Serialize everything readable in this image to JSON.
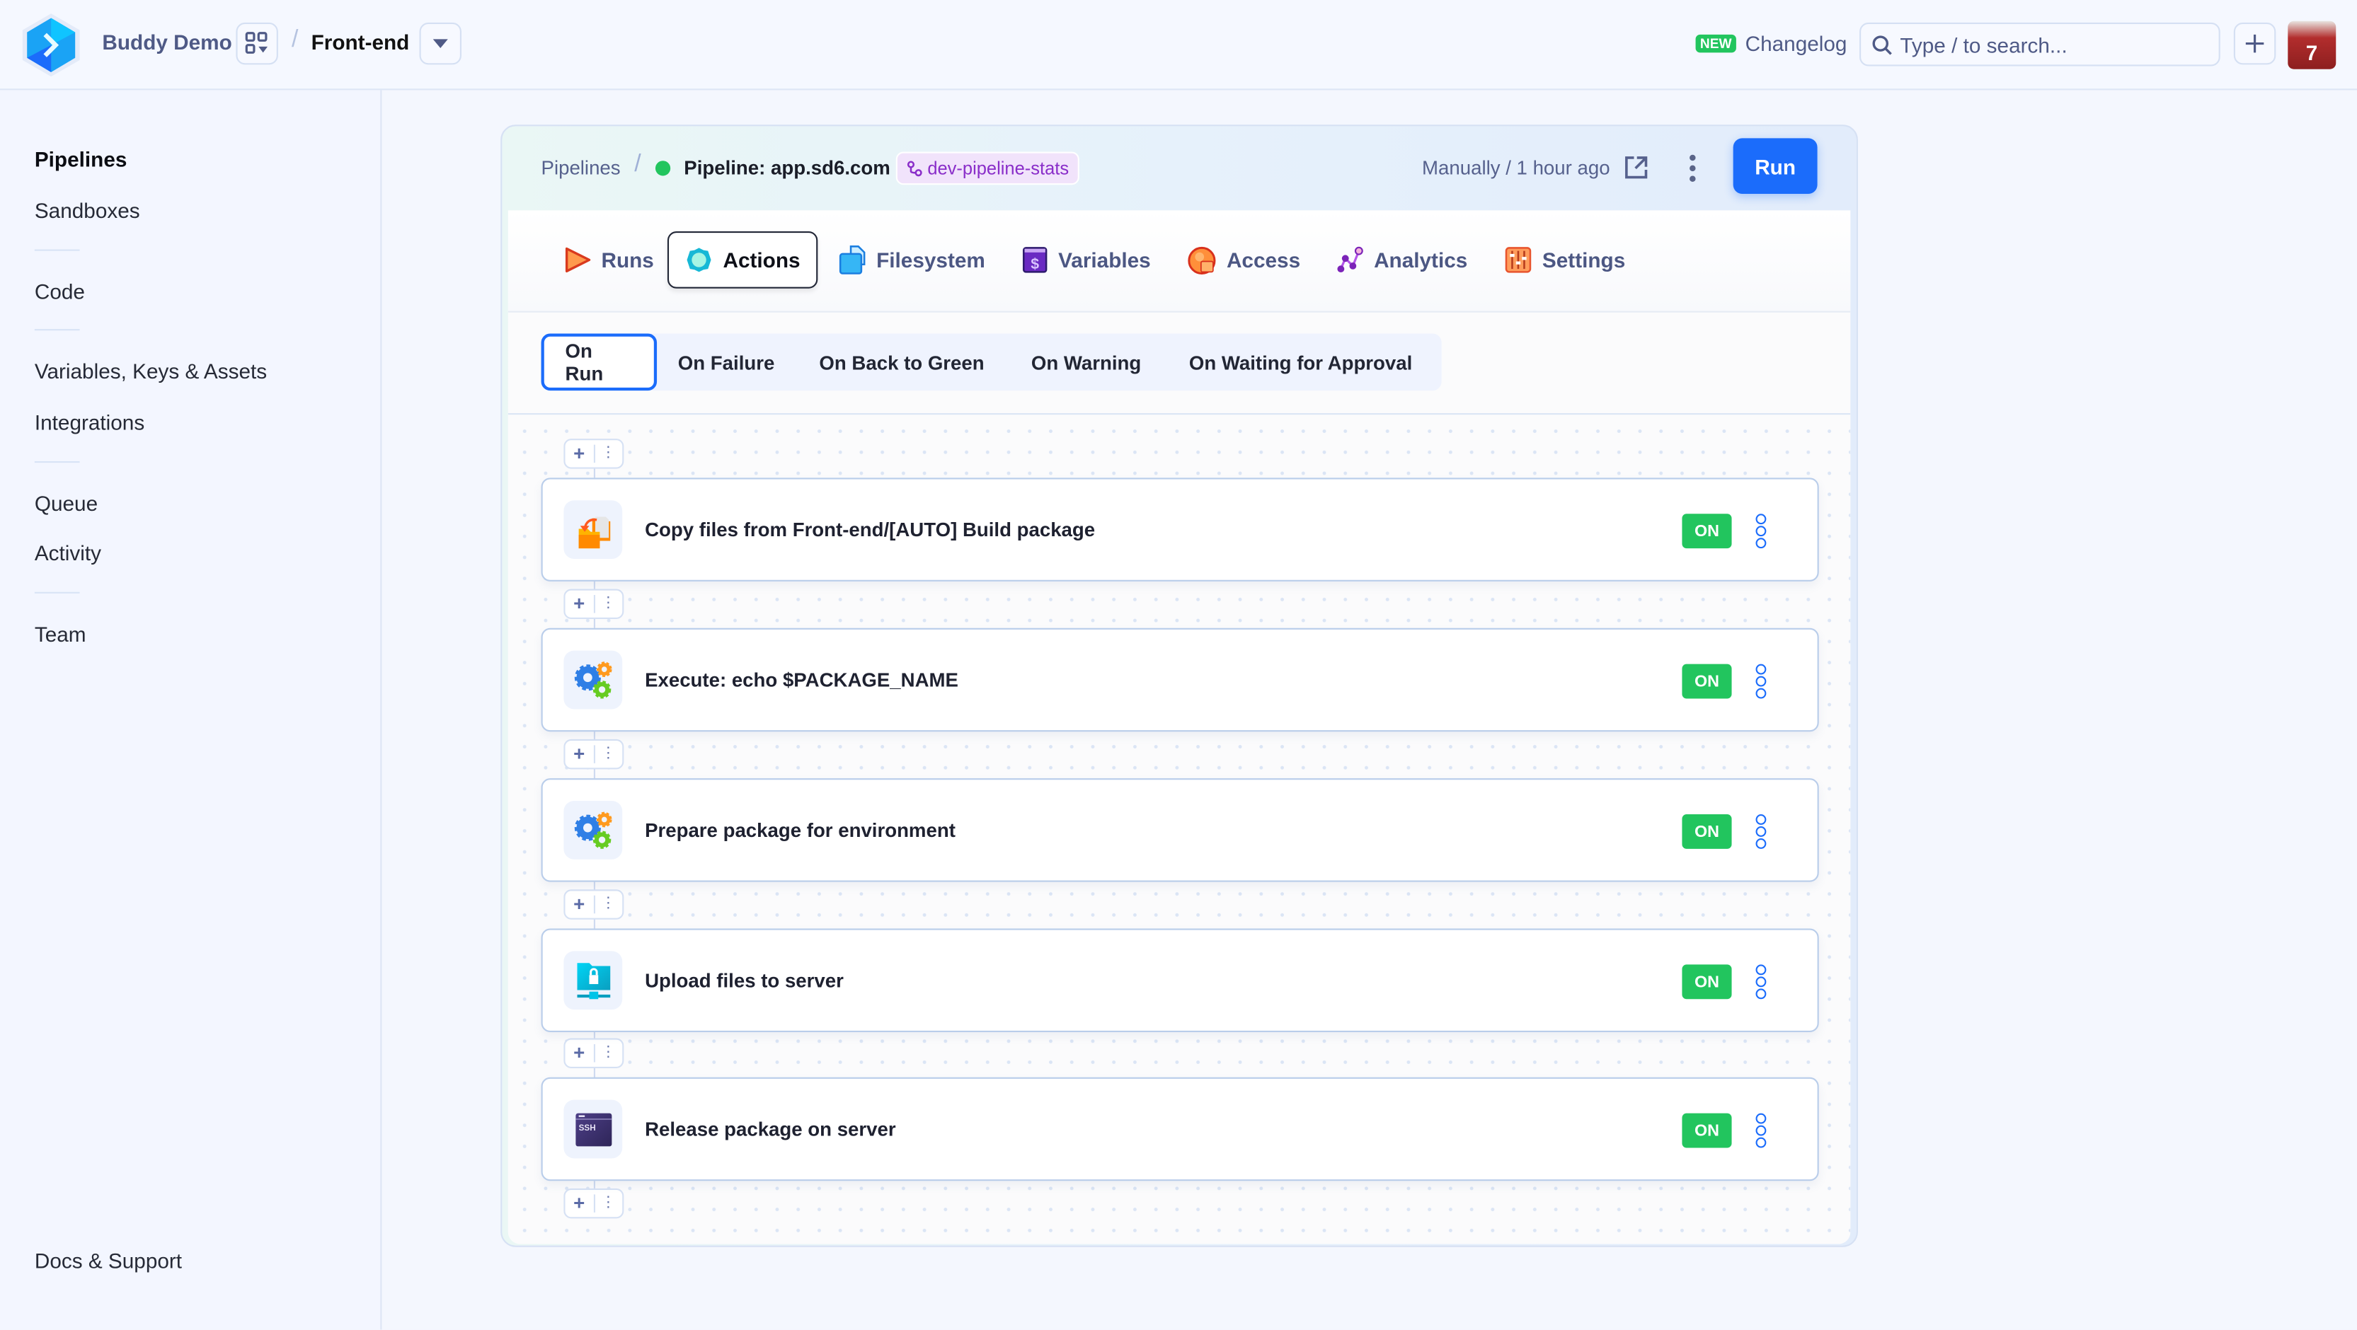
{
  "topbar": {
    "org_name": "Buddy Demo",
    "project_name": "Front-end",
    "new_badge": "NEW",
    "changelog": "Changelog",
    "search_placeholder": "Type / to search...",
    "avatar_number": "7"
  },
  "sidebar": {
    "items": [
      {
        "label": "Pipelines",
        "active": true
      },
      {
        "label": "Sandboxes"
      },
      {
        "label": "Code"
      },
      {
        "label": "Variables, Keys & Assets"
      },
      {
        "label": "Integrations"
      },
      {
        "label": "Queue"
      },
      {
        "label": "Activity"
      },
      {
        "label": "Team"
      }
    ],
    "footer": "Docs & Support"
  },
  "pipeline": {
    "breadcrumb_root": "Pipelines",
    "name": "Pipeline: app.sd6.com",
    "status_color": "#22c55e",
    "branch": "dev-pipeline-stats",
    "last_run": "Manually / 1 hour ago",
    "run_label": "Run",
    "accent": "#1b6cfb"
  },
  "tabs": [
    {
      "label": "Runs",
      "icon": "play-icon"
    },
    {
      "label": "Actions",
      "icon": "gear-icon",
      "active": true
    },
    {
      "label": "Filesystem",
      "icon": "file-icon"
    },
    {
      "label": "Variables",
      "icon": "dollar-icon"
    },
    {
      "label": "Access",
      "icon": "user-lock-icon"
    },
    {
      "label": "Analytics",
      "icon": "analytics-icon"
    },
    {
      "label": "Settings",
      "icon": "sliders-icon"
    }
  ],
  "subtabs": [
    {
      "label": "On Run",
      "active": true
    },
    {
      "label": "On Failure"
    },
    {
      "label": "On Back to Green"
    },
    {
      "label": "On Warning"
    },
    {
      "label": "On Waiting for Approval"
    }
  ],
  "actions": [
    {
      "name": "Copy files from Front-end/[AUTO] Build package",
      "icon": "copy-files-icon",
      "status": "ON"
    },
    {
      "name": "Execute: echo $PACKAGE_NAME",
      "icon": "gears-icon",
      "status": "ON"
    },
    {
      "name": "Prepare package for environment",
      "icon": "gears-icon",
      "status": "ON"
    },
    {
      "name": "Upload files to server",
      "icon": "sftp-folder-icon",
      "status": "ON"
    },
    {
      "name": "Release package on server",
      "icon": "ssh-terminal-icon",
      "status": "ON"
    }
  ],
  "add_control": {
    "plus": "+",
    "more": "⋮"
  }
}
